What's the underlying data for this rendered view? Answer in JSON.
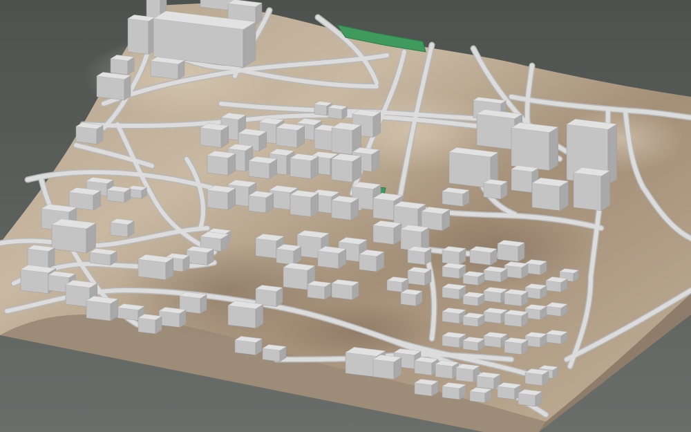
{
  "scene": {
    "kind": "3d-city-terrain-model",
    "background": {
      "top": "#4d524e",
      "bottom": "#6a6e6b"
    },
    "colors": {
      "terrain_light": "#c9b8a0",
      "terrain_dark": "#8e7c68",
      "terrain_side": "#a0907c",
      "road": "#dcdcdc",
      "road_edge": "#b8b8b8",
      "building_top": "#e2e2e2",
      "building_left": "#c4c4c4",
      "building_right": "#a9a9a9",
      "park": "#3f9a5e",
      "park_edge": "#2f7a48"
    },
    "green_areas": 2
  }
}
